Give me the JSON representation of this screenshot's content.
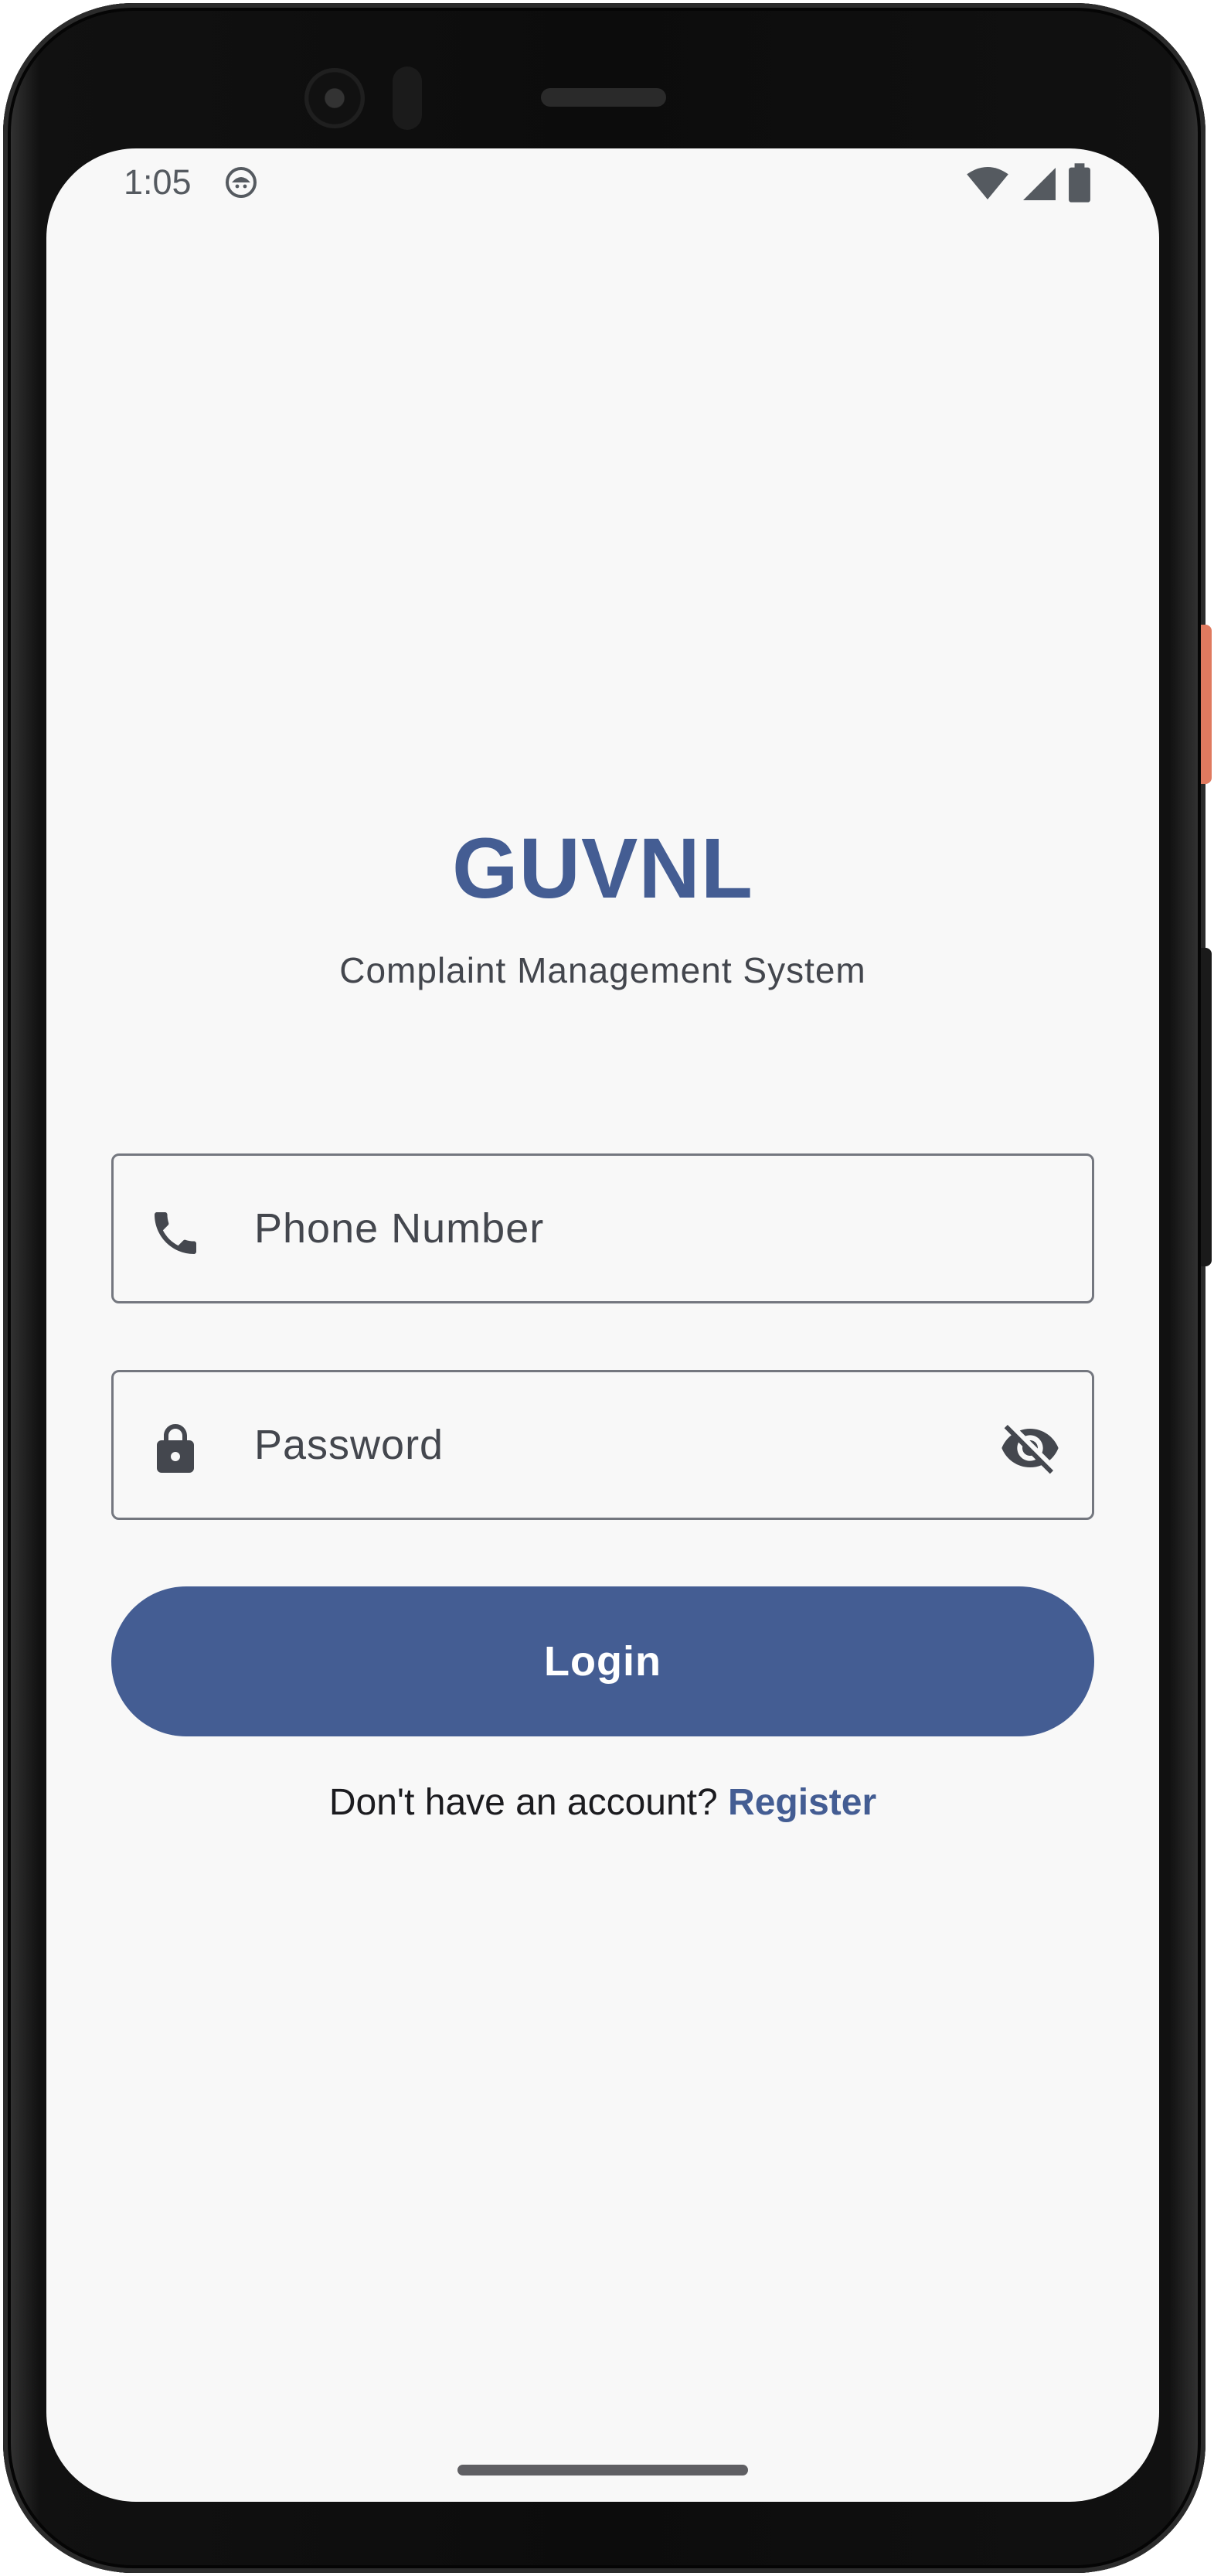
{
  "status_bar": {
    "time": "1:05",
    "notification_icon": "android-face-icon",
    "wifi_icon": "wifi-icon",
    "signal_icon": "cell-signal-icon",
    "battery_icon": "battery-icon"
  },
  "header": {
    "title": "GUVNL",
    "subtitle": "Complaint Management System"
  },
  "form": {
    "phone": {
      "placeholder": "Phone Number",
      "value": "",
      "icon": "phone-icon"
    },
    "password": {
      "placeholder": "Password",
      "value": "",
      "icon": "lock-icon",
      "toggle_icon": "visibility-off-icon"
    },
    "login_label": "Login"
  },
  "footer": {
    "prompt": "Don't have an account? ",
    "register_label": "Register"
  },
  "colors": {
    "primary": "#445d93",
    "background": "#f8f8f8",
    "outline": "#74777f",
    "text": "#44474e"
  }
}
